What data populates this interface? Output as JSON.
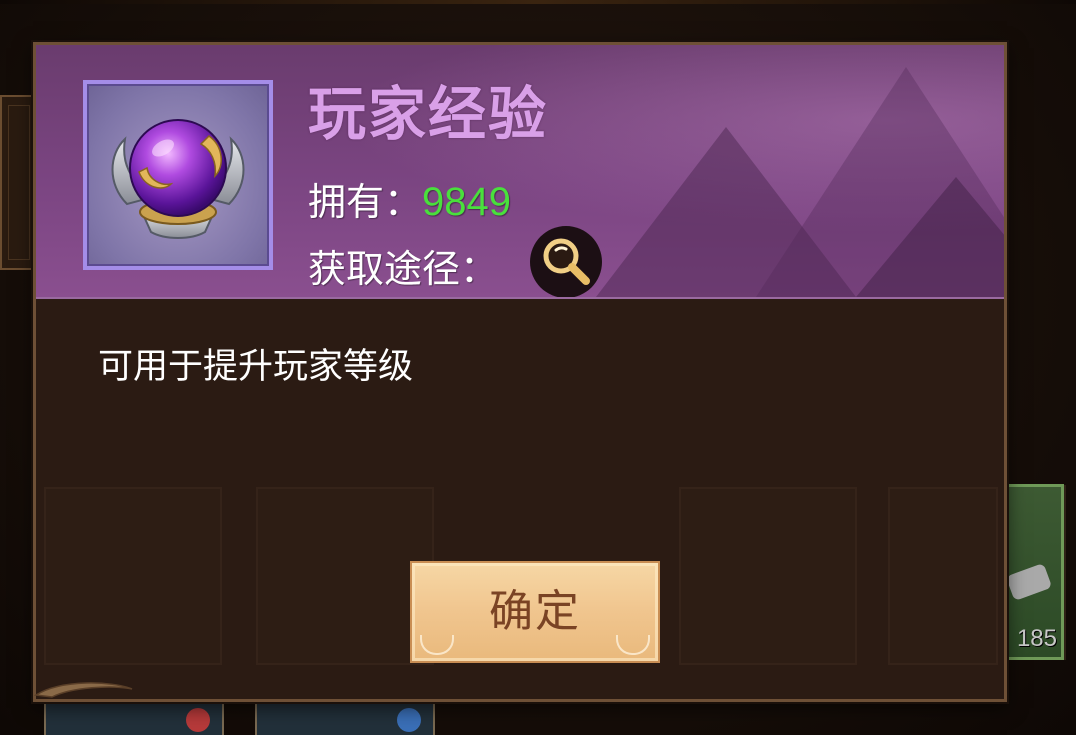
{
  "background": {
    "side_card_count": "185"
  },
  "dialog": {
    "item_name": "玩家经验",
    "owned_label": "拥有：",
    "owned_value": "9849",
    "source_label": "获取途径：",
    "search_icon": "magnifier-icon",
    "item_icon": "purple-orb-icon",
    "description": "可用于提升玩家等级",
    "confirm_label": "确定"
  },
  "colors": {
    "item_name": "#d9a0e8",
    "owned_value": "#49e03c",
    "header_purple": "#7b4582",
    "item_frame_border": "#a48de8",
    "button_fill": "#f0c58e",
    "button_text": "#7a4324",
    "panel_bg": "#2b1b13"
  }
}
